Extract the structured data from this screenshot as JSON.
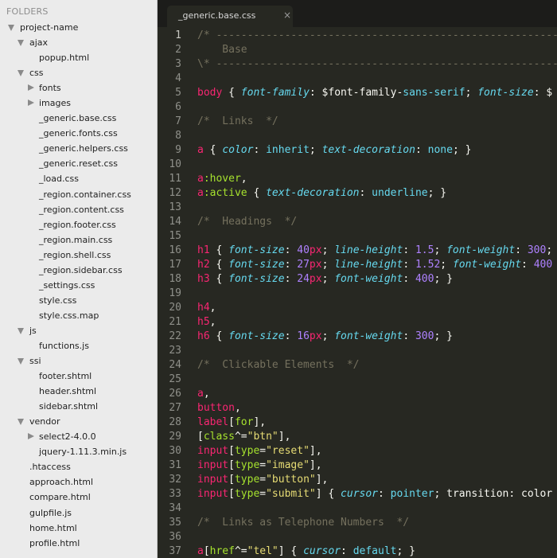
{
  "sidebar": {
    "header": "FOLDERS",
    "items": [
      {
        "label": "project-name",
        "depth": 0,
        "type": "folder",
        "expanded": true
      },
      {
        "label": "ajax",
        "depth": 1,
        "type": "folder",
        "expanded": true
      },
      {
        "label": "popup.html",
        "depth": 2,
        "type": "file"
      },
      {
        "label": "css",
        "depth": 1,
        "type": "folder",
        "expanded": true
      },
      {
        "label": "fonts",
        "depth": 2,
        "type": "folder",
        "expanded": false
      },
      {
        "label": "images",
        "depth": 2,
        "type": "folder",
        "expanded": false
      },
      {
        "label": "_generic.base.css",
        "depth": 2,
        "type": "file"
      },
      {
        "label": "_generic.fonts.css",
        "depth": 2,
        "type": "file"
      },
      {
        "label": "_generic.helpers.css",
        "depth": 2,
        "type": "file"
      },
      {
        "label": "_generic.reset.css",
        "depth": 2,
        "type": "file"
      },
      {
        "label": "_load.css",
        "depth": 2,
        "type": "file"
      },
      {
        "label": "_region.container.css",
        "depth": 2,
        "type": "file"
      },
      {
        "label": "_region.content.css",
        "depth": 2,
        "type": "file"
      },
      {
        "label": "_region.footer.css",
        "depth": 2,
        "type": "file"
      },
      {
        "label": "_region.main.css",
        "depth": 2,
        "type": "file"
      },
      {
        "label": "_region.shell.css",
        "depth": 2,
        "type": "file"
      },
      {
        "label": "_region.sidebar.css",
        "depth": 2,
        "type": "file"
      },
      {
        "label": "_settings.css",
        "depth": 2,
        "type": "file"
      },
      {
        "label": "style.css",
        "depth": 2,
        "type": "file"
      },
      {
        "label": "style.css.map",
        "depth": 2,
        "type": "file"
      },
      {
        "label": "js",
        "depth": 1,
        "type": "folder",
        "expanded": true
      },
      {
        "label": "functions.js",
        "depth": 2,
        "type": "file"
      },
      {
        "label": "ssi",
        "depth": 1,
        "type": "folder",
        "expanded": true
      },
      {
        "label": "footer.shtml",
        "depth": 2,
        "type": "file"
      },
      {
        "label": "header.shtml",
        "depth": 2,
        "type": "file"
      },
      {
        "label": "sidebar.shtml",
        "depth": 2,
        "type": "file"
      },
      {
        "label": "vendor",
        "depth": 1,
        "type": "folder",
        "expanded": true
      },
      {
        "label": "select2-4.0.0",
        "depth": 2,
        "type": "folder",
        "expanded": false
      },
      {
        "label": "jquery-1.11.3.min.js",
        "depth": 2,
        "type": "file"
      },
      {
        "label": ".htaccess",
        "depth": 1,
        "type": "file"
      },
      {
        "label": "approach.html",
        "depth": 1,
        "type": "file"
      },
      {
        "label": "compare.html",
        "depth": 1,
        "type": "file"
      },
      {
        "label": "gulpfile.js",
        "depth": 1,
        "type": "file"
      },
      {
        "label": "home.html",
        "depth": 1,
        "type": "file"
      },
      {
        "label": "profile.html",
        "depth": 1,
        "type": "file"
      }
    ]
  },
  "tab": {
    "title": "_generic.base.css",
    "close_glyph": "×"
  },
  "editor": {
    "current_line": 1,
    "colors": {
      "background": "#272822",
      "comment": "#75715e",
      "tag": "#f92672",
      "property": "#66d9ef",
      "number": "#ae81ff",
      "string": "#e6db74",
      "attribute": "#a6e22e"
    },
    "lines": [
      {
        "n": "1",
        "tokens": [
          [
            "c",
            "/* ------------------------------------------------------------"
          ]
        ]
      },
      {
        "n": "2",
        "tokens": [
          [
            "c",
            "    Base"
          ]
        ]
      },
      {
        "n": "3",
        "tokens": [
          [
            "c",
            "\\* ------------------------------------------------------------"
          ]
        ]
      },
      {
        "n": "4",
        "tokens": []
      },
      {
        "n": "5",
        "tokens": [
          [
            "t",
            "body"
          ],
          [
            "p",
            " { "
          ],
          [
            "k",
            "font-family"
          ],
          [
            "p",
            ": $font-family-"
          ],
          [
            "v",
            "sans-serif"
          ],
          [
            "p",
            "; "
          ],
          [
            "k",
            "font-size"
          ],
          [
            "p",
            ": $"
          ]
        ]
      },
      {
        "n": "6",
        "tokens": []
      },
      {
        "n": "7",
        "tokens": [
          [
            "c",
            "/*  Links  */"
          ]
        ]
      },
      {
        "n": "8",
        "tokens": []
      },
      {
        "n": "9",
        "tokens": [
          [
            "t",
            "a"
          ],
          [
            "p",
            " { "
          ],
          [
            "k",
            "color"
          ],
          [
            "p",
            ": "
          ],
          [
            "v",
            "inherit"
          ],
          [
            "p",
            "; "
          ],
          [
            "k",
            "text-decoration"
          ],
          [
            "p",
            ": "
          ],
          [
            "v",
            "none"
          ],
          [
            "p",
            "; }"
          ]
        ]
      },
      {
        "n": "10",
        "tokens": []
      },
      {
        "n": "11",
        "tokens": [
          [
            "t",
            "a"
          ],
          [
            "a",
            ":hover"
          ],
          [
            "p",
            ","
          ]
        ]
      },
      {
        "n": "12",
        "tokens": [
          [
            "t",
            "a"
          ],
          [
            "a",
            ":active"
          ],
          [
            "p",
            " { "
          ],
          [
            "k",
            "text-decoration"
          ],
          [
            "p",
            ": "
          ],
          [
            "v",
            "underline"
          ],
          [
            "p",
            "; }"
          ]
        ]
      },
      {
        "n": "13",
        "tokens": []
      },
      {
        "n": "14",
        "tokens": [
          [
            "c",
            "/*  Headings  */"
          ]
        ]
      },
      {
        "n": "15",
        "tokens": []
      },
      {
        "n": "16",
        "tokens": [
          [
            "t",
            "h1"
          ],
          [
            "p",
            " { "
          ],
          [
            "k",
            "font-size"
          ],
          [
            "p",
            ": "
          ],
          [
            "n",
            "40"
          ],
          [
            "u",
            "px"
          ],
          [
            "p",
            "; "
          ],
          [
            "k",
            "line-height"
          ],
          [
            "p",
            ": "
          ],
          [
            "n",
            "1.5"
          ],
          [
            "p",
            "; "
          ],
          [
            "k",
            "font-weight"
          ],
          [
            "p",
            ": "
          ],
          [
            "n",
            "300"
          ],
          [
            "p",
            ";"
          ]
        ]
      },
      {
        "n": "17",
        "tokens": [
          [
            "t",
            "h2"
          ],
          [
            "p",
            " { "
          ],
          [
            "k",
            "font-size"
          ],
          [
            "p",
            ": "
          ],
          [
            "n",
            "27"
          ],
          [
            "u",
            "px"
          ],
          [
            "p",
            "; "
          ],
          [
            "k",
            "line-height"
          ],
          [
            "p",
            ": "
          ],
          [
            "n",
            "1.52"
          ],
          [
            "p",
            "; "
          ],
          [
            "k",
            "font-weight"
          ],
          [
            "p",
            ": "
          ],
          [
            "n",
            "400"
          ]
        ]
      },
      {
        "n": "18",
        "tokens": [
          [
            "t",
            "h3"
          ],
          [
            "p",
            " { "
          ],
          [
            "k",
            "font-size"
          ],
          [
            "p",
            ": "
          ],
          [
            "n",
            "24"
          ],
          [
            "u",
            "px"
          ],
          [
            "p",
            "; "
          ],
          [
            "k",
            "font-weight"
          ],
          [
            "p",
            ": "
          ],
          [
            "n",
            "400"
          ],
          [
            "p",
            "; }"
          ]
        ]
      },
      {
        "n": "19",
        "tokens": []
      },
      {
        "n": "20",
        "tokens": [
          [
            "t",
            "h4"
          ],
          [
            "p",
            ","
          ]
        ]
      },
      {
        "n": "21",
        "tokens": [
          [
            "t",
            "h5"
          ],
          [
            "p",
            ","
          ]
        ]
      },
      {
        "n": "22",
        "tokens": [
          [
            "t",
            "h6"
          ],
          [
            "p",
            " { "
          ],
          [
            "k",
            "font-size"
          ],
          [
            "p",
            ": "
          ],
          [
            "n",
            "16"
          ],
          [
            "u",
            "px"
          ],
          [
            "p",
            "; "
          ],
          [
            "k",
            "font-weight"
          ],
          [
            "p",
            ": "
          ],
          [
            "n",
            "300"
          ],
          [
            "p",
            "; }"
          ]
        ]
      },
      {
        "n": "23",
        "tokens": []
      },
      {
        "n": "24",
        "tokens": [
          [
            "c",
            "/*  Clickable Elements  */"
          ]
        ]
      },
      {
        "n": "25",
        "tokens": []
      },
      {
        "n": "26",
        "tokens": [
          [
            "t",
            "a"
          ],
          [
            "p",
            ","
          ]
        ]
      },
      {
        "n": "27",
        "tokens": [
          [
            "t",
            "button"
          ],
          [
            "p",
            ","
          ]
        ]
      },
      {
        "n": "28",
        "tokens": [
          [
            "t",
            "label"
          ],
          [
            "p",
            "["
          ],
          [
            "a",
            "for"
          ],
          [
            "p",
            "],"
          ]
        ]
      },
      {
        "n": "29",
        "tokens": [
          [
            "p",
            "["
          ],
          [
            "a",
            "class"
          ],
          [
            "p",
            "^="
          ],
          [
            "s",
            "\"btn\""
          ],
          [
            "p",
            "],"
          ]
        ]
      },
      {
        "n": "30",
        "tokens": [
          [
            "t",
            "input"
          ],
          [
            "p",
            "["
          ],
          [
            "a",
            "type"
          ],
          [
            "p",
            "="
          ],
          [
            "s",
            "\"reset\""
          ],
          [
            "p",
            "],"
          ]
        ]
      },
      {
        "n": "31",
        "tokens": [
          [
            "t",
            "input"
          ],
          [
            "p",
            "["
          ],
          [
            "a",
            "type"
          ],
          [
            "p",
            "="
          ],
          [
            "s",
            "\"image\""
          ],
          [
            "p",
            "],"
          ]
        ]
      },
      {
        "n": "32",
        "tokens": [
          [
            "t",
            "input"
          ],
          [
            "p",
            "["
          ],
          [
            "a",
            "type"
          ],
          [
            "p",
            "="
          ],
          [
            "s",
            "\"button\""
          ],
          [
            "p",
            "],"
          ]
        ]
      },
      {
        "n": "33",
        "tokens": [
          [
            "t",
            "input"
          ],
          [
            "p",
            "["
          ],
          [
            "a",
            "type"
          ],
          [
            "p",
            "="
          ],
          [
            "s",
            "\"submit\""
          ],
          [
            "p",
            "] { "
          ],
          [
            "k",
            "cursor"
          ],
          [
            "p",
            ": "
          ],
          [
            "v",
            "pointer"
          ],
          [
            "p",
            "; transition: color"
          ]
        ]
      },
      {
        "n": "34",
        "tokens": []
      },
      {
        "n": "35",
        "tokens": [
          [
            "c",
            "/*  Links as Telephone Numbers  */"
          ]
        ]
      },
      {
        "n": "36",
        "tokens": []
      },
      {
        "n": "37",
        "tokens": [
          [
            "t",
            "a"
          ],
          [
            "p",
            "["
          ],
          [
            "a",
            "href"
          ],
          [
            "p",
            "^="
          ],
          [
            "s",
            "\"tel\""
          ],
          [
            "p",
            "] { "
          ],
          [
            "k",
            "cursor"
          ],
          [
            "p",
            ": "
          ],
          [
            "v",
            "default"
          ],
          [
            "p",
            "; }"
          ]
        ]
      }
    ]
  }
}
